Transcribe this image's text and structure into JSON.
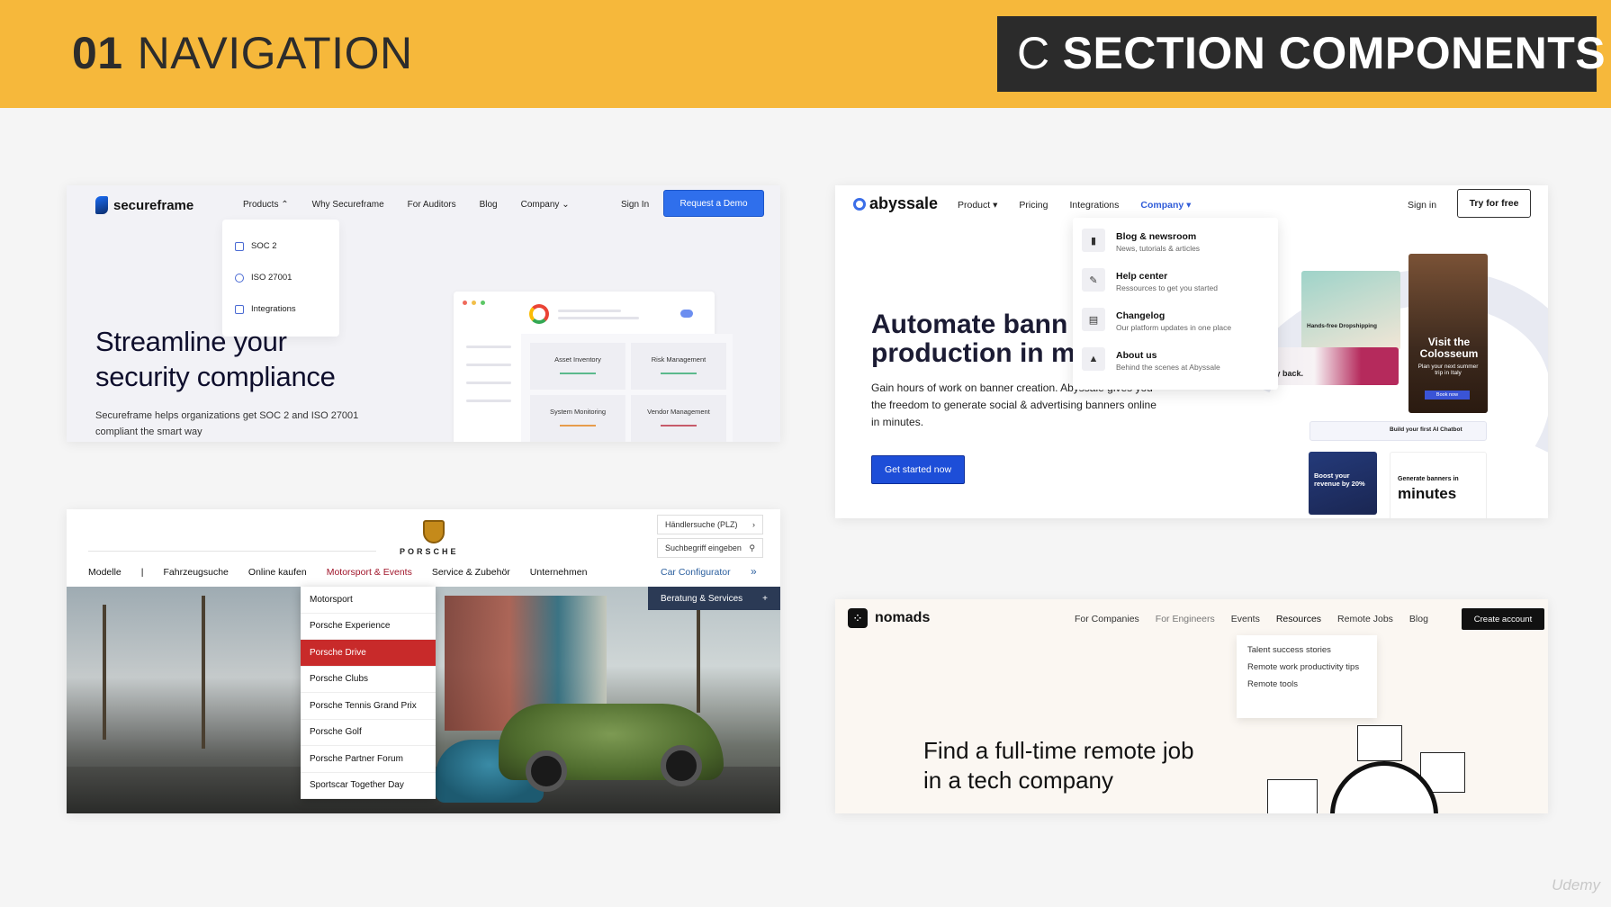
{
  "header": {
    "num": "01",
    "title": "NAVIGATION",
    "right_prefix": "C",
    "right_title": "SECTION COMPONENTS"
  },
  "secureframe": {
    "logo": "secureframe",
    "nav": [
      "Products",
      "Why Secureframe",
      "For Auditors",
      "Blog",
      "Company"
    ],
    "signin": "Sign In",
    "demo": "Request a Demo",
    "dropdown": [
      "SOC 2",
      "ISO 27001",
      "Integrations"
    ],
    "headline_1": "Streamline your",
    "headline_2": "security compliance",
    "sub": "Secureframe helps organizations get SOC 2 and ISO 27001 compliant the smart way",
    "cards": [
      "Asset Inventory",
      "Risk Management",
      "System Monitoring",
      "Vendor Management"
    ]
  },
  "abyssale": {
    "logo": "abyssale",
    "nav": [
      "Product",
      "Pricing",
      "Integrations",
      "Company"
    ],
    "signin": "Sign in",
    "try": "Try for free",
    "headline_1": "Automate bann",
    "headline_2": "production in m",
    "paragraph": "Gain hours of work on banner creation. Abyssale gives you the freedom to generate social & advertising banners online in minutes.",
    "cta": "Get started now",
    "dropdown": [
      {
        "title": "Blog & newsroom",
        "sub": "News, tutorials & articles"
      },
      {
        "title": "Help center",
        "sub": "Ressources to get you started"
      },
      {
        "title": "Changelog",
        "sub": "Our platform updates in one place"
      },
      {
        "title": "About us",
        "sub": "Behind the scenes at Abyssale"
      }
    ],
    "ads": {
      "colosseum_title": "Visit the Colosseum",
      "colosseum_sub": "Plan your next summer trip in Italy",
      "book": "Book now",
      "dropship": "Hands-free Dropshipping",
      "money_back": "or your money back.",
      "chatbot": "Build your first AI Chatbot",
      "boost": "Boost your revenue by 20%",
      "minutes_pre": "Generate banners in",
      "minutes": "minutes"
    }
  },
  "porsche": {
    "brand": "PORSCHE",
    "dealer": "Händlersuche (PLZ)",
    "search": "Suchbegriff eingeben",
    "nav": [
      "Modelle",
      "|",
      "Fahrzeugsuche",
      "Online kaufen",
      "Motorsport & Events",
      "Service & Zubehör",
      "Unternehmen"
    ],
    "configurator": "Car Configurator",
    "beratung": "Beratung & Services",
    "dropdown": [
      "Motorsport",
      "Porsche Experience",
      "Porsche Drive",
      "Porsche Clubs",
      "Porsche Tennis Grand Prix",
      "Porsche Golf",
      "Porsche Partner Forum",
      "Sportscar Together Day"
    ],
    "selected_index": 2
  },
  "nomads": {
    "logo": "nomads",
    "nav": [
      "For Companies",
      "For Engineers",
      "Events",
      "Resources",
      "Remote Jobs",
      "Blog"
    ],
    "create": "Create account",
    "dropdown": [
      "Talent success stories",
      "Remote work productivity tips",
      "Remote tools"
    ],
    "headline": "Find a full-time remote job in a tech company"
  },
  "watermark": "Udemy"
}
